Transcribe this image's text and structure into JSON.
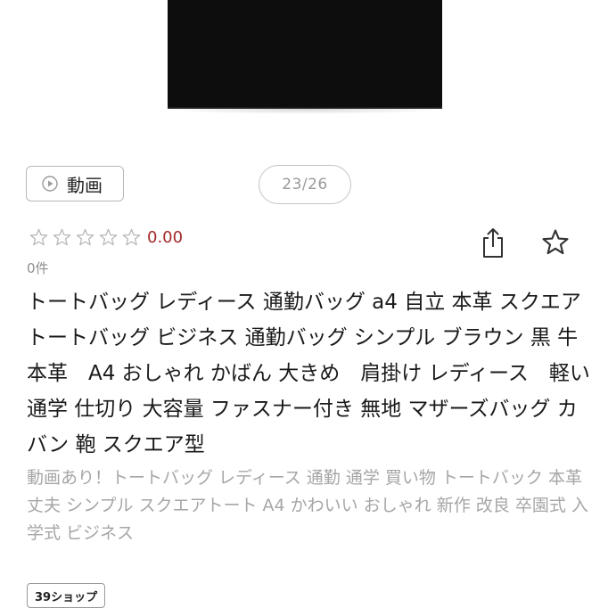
{
  "product_image": {
    "icon": "black-tote-bag-photo"
  },
  "media": {
    "video_label": "動画",
    "video_icon": "play-circle-icon",
    "image_counter": "23/26"
  },
  "rating": {
    "stars_filled": 0,
    "stars_total": 5,
    "value": "0.00",
    "review_count": "0件",
    "value_color": "#a32a2a"
  },
  "actions": {
    "share_icon": "share-icon",
    "favorite_icon": "star-outline-icon"
  },
  "product": {
    "title": "トートバッグ レディース 通勤バッグ a4 自立 本革 スクエアトートバッグ ビジネス 通勤バッグ シンプル ブラウン 黒 牛本革　A4 おしゃれ かばん 大きめ　肩掛け レディース　軽い　通学 仕切り 大容量 ファスナー付き 無地 マザーズバッグ カバン 鞄 スクエア型",
    "catch_copy": "動画あり！トートバッグ レディース 通勤 通学 買い物 トートバック 本革　丈夫 シンプル スクエアトート A4 かわいい おしゃれ 新作 改良 卒園式 入学式 ビジネス"
  },
  "shop": {
    "badge_label": "39ショップ"
  }
}
